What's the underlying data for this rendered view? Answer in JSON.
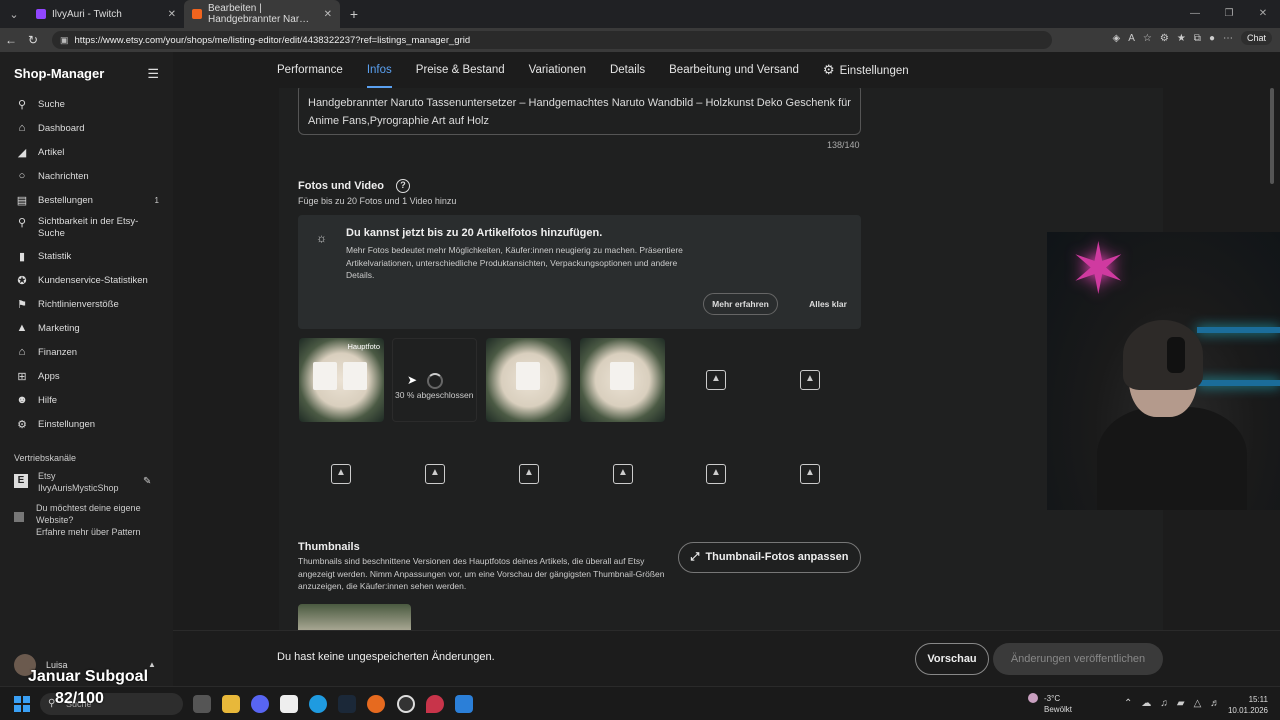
{
  "browser": {
    "tabs": [
      {
        "label": "IlvyAuri - Twitch",
        "favicon_color": "#9146ff",
        "active": false
      },
      {
        "label": "Bearbeiten | Handgebrannter Nar…",
        "favicon_color": "#f1641e",
        "active": true
      }
    ],
    "url": "https://www.etsy.com/your/shops/me/listing-editor/edit/4438322237?ref=listings_manager_grid",
    "chat_label": "Chat"
  },
  "sidebar": {
    "title": "Shop-Manager",
    "items": [
      {
        "label": "Suche",
        "icon": "search-icon"
      },
      {
        "label": "Dashboard",
        "icon": "home-icon"
      },
      {
        "label": "Artikel",
        "icon": "tag-icon"
      },
      {
        "label": "Nachrichten",
        "icon": "chat-icon"
      },
      {
        "label": "Bestellungen",
        "icon": "list-icon",
        "badge": "1"
      },
      {
        "label": "Sichtbarkeit in der Etsy-Suche",
        "icon": "visibility-icon"
      },
      {
        "label": "Statistik",
        "icon": "chart-icon"
      },
      {
        "label": "Kundenservice-Statistiken",
        "icon": "star-icon"
      },
      {
        "label": "Richtlinienverstöße",
        "icon": "flag-icon"
      },
      {
        "label": "Marketing",
        "icon": "megaphone-icon"
      },
      {
        "label": "Finanzen",
        "icon": "bank-icon"
      },
      {
        "label": "Apps",
        "icon": "apps-icon"
      },
      {
        "label": "Hilfe",
        "icon": "people-icon"
      },
      {
        "label": "Einstellungen",
        "icon": "gear-icon"
      }
    ],
    "channels_title": "Vertriebskanäle",
    "etsy_label": "Etsy",
    "shop_name": "IlvyAurisMysticShop",
    "own_site_question": "Du möchtest deine eigene Website?",
    "own_site_link": "Erfahre mehr über Pattern",
    "user_name": "Luisa"
  },
  "overlay": {
    "subgoal_title": "Januar Subgoal",
    "subgoal_value": "82/100"
  },
  "topnav": {
    "tabs": [
      "Performance",
      "Infos",
      "Preise & Bestand",
      "Variationen",
      "Details",
      "Bearbeitung und Versand",
      "Einstellungen"
    ],
    "active": "Infos"
  },
  "listing": {
    "title_text": "Handgebrannter Naruto Tassenuntersetzer  – Handgemachtes Naruto Wandbild – Holzkunst Deko Geschenk für Anime Fans,Pyrographie Art auf Holz",
    "title_counter": "138/140"
  },
  "photos": {
    "heading": "Fotos und Video",
    "subtext": "Füge bis zu 20 Fotos und 1 Video hinzu",
    "info_heading": "Du kannst jetzt bis zu 20 Artikelfotos hinzufügen.",
    "info_text": "Mehr Fotos bedeutet mehr Möglichkeiten, Käufer:innen neugierig zu machen. Präsentiere Artikelvariationen, unterschiedliche Produktansichten, Verpackungsoptionen und andere Details.",
    "learn_more": "Mehr erfahren",
    "dismiss": "Alles klar",
    "main_photo_tag": "Hauptfoto",
    "upload_progress": "30 % abgeschlossen"
  },
  "thumbnails": {
    "heading": "Thumbnails",
    "text": "Thumbnails sind beschnittene Versionen des Hauptfotos deines Artikels, die überall auf Etsy angezeigt werden. Nimm Anpassungen vor, um eine Vorschau der gängigsten Thumbnail-Größen anzuzeigen, die Käufer:innen sehen werden.",
    "adjust_button": "Thumbnail-Fotos anpassen"
  },
  "savebar": {
    "message": "Du hast keine ungespeicherten Änderungen.",
    "preview": "Vorschau",
    "publish": "Änderungen veröffentlichen"
  },
  "taskbar": {
    "search_placeholder": "Suche",
    "weather_temp": "-3°C",
    "weather_desc": "Bewölkt",
    "time": "15:11",
    "date": "10.01.2026"
  }
}
